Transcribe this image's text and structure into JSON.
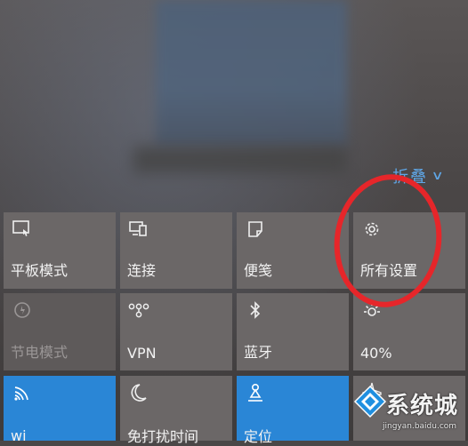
{
  "header": {
    "collapse_label": "折叠"
  },
  "tiles": [
    {
      "label": "平板模式",
      "icon": "tablet-mode-icon",
      "state": "normal"
    },
    {
      "label": "连接",
      "icon": "connect-icon",
      "state": "normal"
    },
    {
      "label": "便笺",
      "icon": "note-icon",
      "state": "normal"
    },
    {
      "label": "所有设置",
      "icon": "gear-icon",
      "state": "normal"
    },
    {
      "label": "节电模式",
      "icon": "battery-saver-icon",
      "state": "disabled"
    },
    {
      "label": "VPN",
      "icon": "vpn-icon",
      "state": "normal"
    },
    {
      "label": "蓝牙",
      "icon": "bluetooth-icon",
      "state": "normal"
    },
    {
      "label": "40%",
      "icon": "brightness-icon",
      "state": "normal"
    },
    {
      "label": "wi",
      "icon": "wifi-icon",
      "state": "active"
    },
    {
      "label": "免打扰时间",
      "icon": "moon-icon",
      "state": "normal"
    },
    {
      "label": "定位",
      "icon": "location-icon",
      "state": "active"
    },
    {
      "label": "",
      "icon": "airplane-icon",
      "state": "normal"
    }
  ],
  "watermark": {
    "brand": "系统城",
    "url": "jingyan.baidu.com"
  },
  "colors": {
    "accent": "#2a86d6",
    "link": "#5fa6e6",
    "highlight_circle": "#e6262a"
  }
}
